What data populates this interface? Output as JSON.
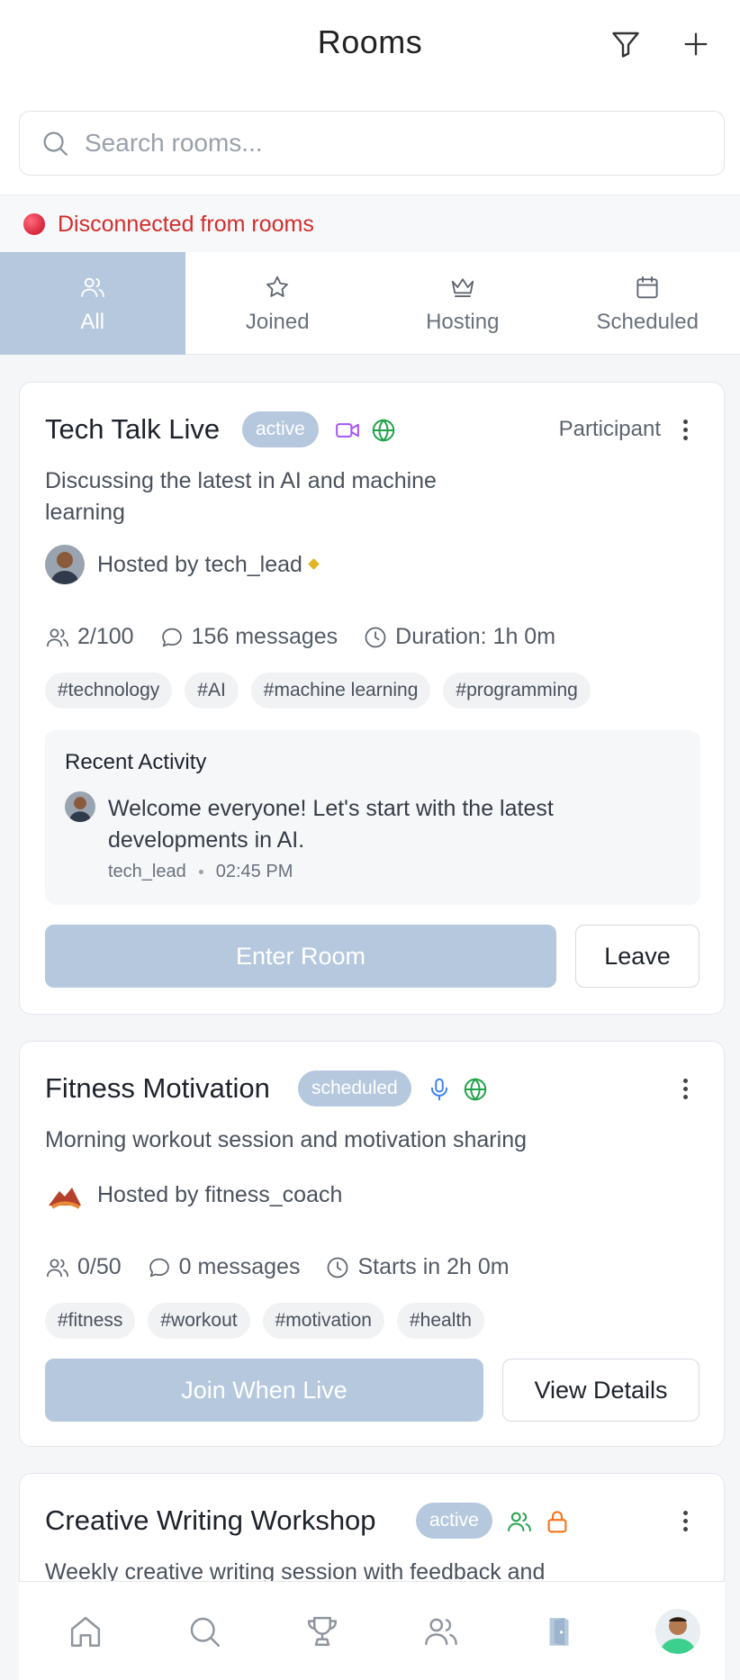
{
  "header": {
    "title": "Rooms",
    "filter_icon": "filter-icon",
    "add_icon": "plus-icon"
  },
  "search": {
    "placeholder": "Search rooms..."
  },
  "connection": {
    "text": "Disconnected from rooms",
    "color": "#d22d2d"
  },
  "tabs": [
    {
      "label": "All",
      "icon": "users-icon",
      "active": true
    },
    {
      "label": "Joined",
      "icon": "star-icon",
      "active": false
    },
    {
      "label": "Hosting",
      "icon": "crown-icon",
      "active": false
    },
    {
      "label": "Scheduled",
      "icon": "calendar-icon",
      "active": false
    }
  ],
  "rooms": [
    {
      "name": "Tech Talk Live",
      "status": "active",
      "type_icons": [
        "video-icon",
        "globe-icon"
      ],
      "role": "Participant",
      "description": "Discussing the latest in AI and machine learning",
      "host": "Hosted by tech_lead",
      "participants": "2/100",
      "messages": "156 messages",
      "time": "Duration: 1h 0m",
      "tags": [
        "#technology",
        "#AI",
        "#machine learning",
        "#programming"
      ],
      "activity": {
        "heading": "Recent Activity",
        "message": "Welcome everyone! Let's start with the latest developments in AI.",
        "author": "tech_lead",
        "time": "02:45 PM"
      },
      "primary_action": "Enter Room",
      "secondary_action": "Leave"
    },
    {
      "name": "Fitness Motivation",
      "status": "scheduled",
      "type_icons": [
        "microphone-icon",
        "globe-icon"
      ],
      "description": "Morning workout session and motivation sharing",
      "host": "Hosted by fitness_coach",
      "participants": "0/50",
      "messages": "0 messages",
      "time": "Starts in 2h 0m",
      "tags": [
        "#fitness",
        "#workout",
        "#motivation",
        "#health"
      ],
      "primary_action": "Join When Live",
      "secondary_action": "View Details"
    },
    {
      "name": "Creative Writing Workshop",
      "status": "active",
      "type_icons": [
        "users-icon",
        "lock-icon"
      ],
      "description": "Weekly creative writing session with feedback and"
    }
  ],
  "bottom_nav": [
    "home-icon",
    "search-icon",
    "trophy-icon",
    "users-icon",
    "door-icon",
    "profile-avatar"
  ],
  "colors": {
    "accent": "#b5c8dd",
    "video": "#a855f7",
    "globe": "#22a34a",
    "mic": "#3b82f6",
    "lock": "#f97316"
  }
}
